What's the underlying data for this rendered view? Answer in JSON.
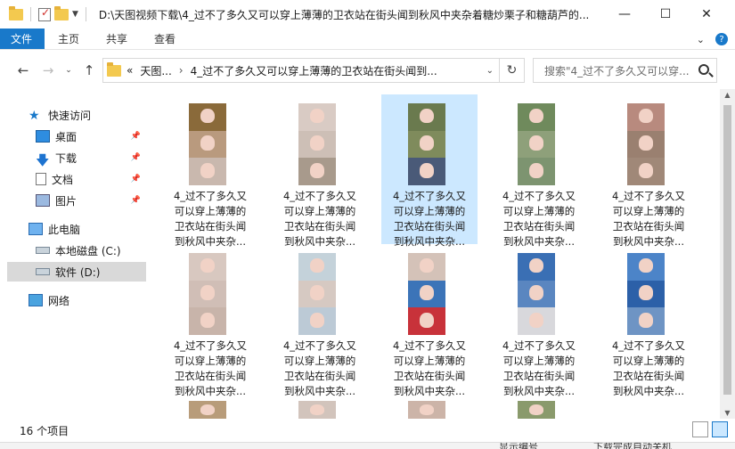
{
  "title_bar": {
    "path": "D:\\天图视频下载\\4_过不了多久又可以穿上薄薄的卫衣站在街头闻到秋风中夹杂着糖炒栗子和糖葫芦的...",
    "minimize": "—",
    "maximize": "☐",
    "close": "✕"
  },
  "ribbon": {
    "tabs": [
      "文件",
      "主页",
      "共享",
      "查看"
    ]
  },
  "address": {
    "overflow": "«",
    "crumbs": [
      "天图...",
      "4_过不了多久又可以穿上薄薄的卫衣站在街头闻到..."
    ],
    "search_placeholder": "搜索\"4_过不了多久又可以穿..."
  },
  "nav": {
    "quick_access": "快速访问",
    "desktop": "桌面",
    "downloads": "下载",
    "documents": "文档",
    "pictures": "图片",
    "this_pc": "此电脑",
    "local_disk": "本地磁盘 (C:)",
    "software": "软件 (D:)",
    "network": "网络"
  },
  "files": [
    {
      "name": "4_过不了多久又\n可以穿上薄薄的\n卫衣站在街头闻\n到秋风中夹杂..."
    },
    {
      "name": "4_过不了多久又\n可以穿上薄薄的\n卫衣站在街头闻\n到秋风中夹杂..."
    },
    {
      "name": "4_过不了多久又\n可以穿上薄薄的\n卫衣站在街头闻\n到秋风中夹杂..."
    },
    {
      "name": "4_过不了多久又\n可以穿上薄薄的\n卫衣站在街头闻\n到秋风中夹杂..."
    },
    {
      "name": "4_过不了多久又\n可以穿上薄薄的\n卫衣站在街头闻\n到秋风中夹杂..."
    },
    {
      "name": "4_过不了多久又\n可以穿上薄薄的\n卫衣站在街头闻\n到秋风中夹杂..."
    },
    {
      "name": "4_过不了多久又\n可以穿上薄薄的\n卫衣站在街头闻\n到秋风中夹杂..."
    },
    {
      "name": "4_过不了多久又\n可以穿上薄薄的\n卫衣站在街头闻\n到秋风中夹杂..."
    },
    {
      "name": "4_过不了多久又\n可以穿上薄薄的\n卫衣站在街头闻\n到秋风中夹杂..."
    },
    {
      "name": "4_过不了多久又\n可以穿上薄薄的\n卫衣站在街头闻\n到秋风中夹杂..."
    }
  ],
  "status": {
    "count": "16 个项目"
  },
  "bottom_strip": {
    "left": "显示编号",
    "right": "下载完成自动关机"
  },
  "colors": {
    "accent": "#1979ca",
    "selection": "#cce8ff"
  }
}
